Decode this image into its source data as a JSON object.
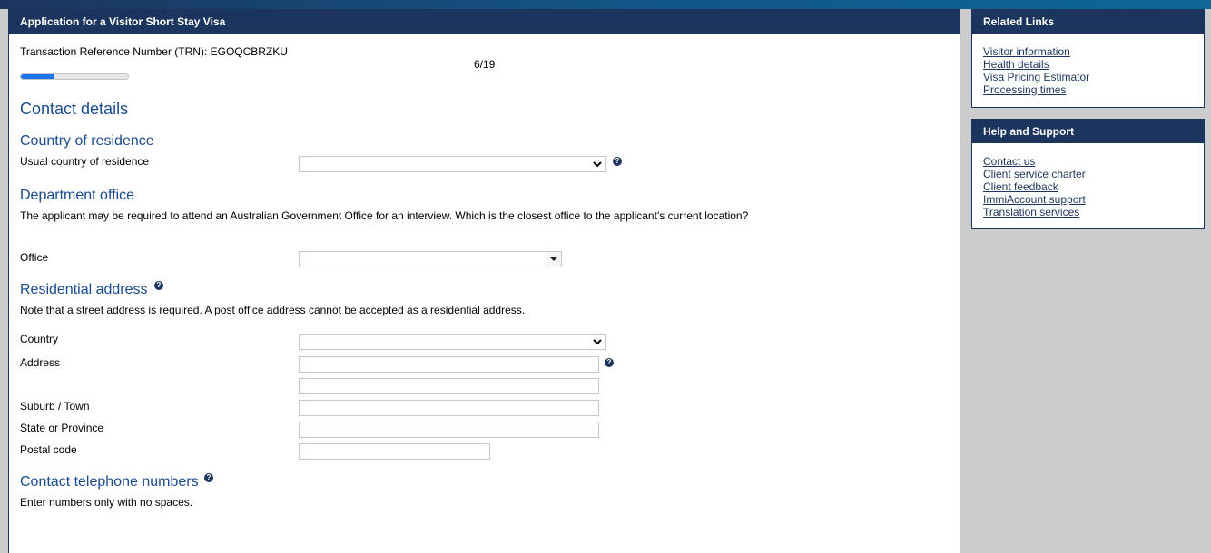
{
  "main": {
    "header_title": "Application for a Visitor Short Stay Visa",
    "trn_label": "Transaction Reference Number (TRN): EGOQCBRZKU",
    "step_text": "6/19",
    "progress_fraction": 0.316,
    "page_title": "Contact details",
    "country_of_residence": {
      "heading": "Country of residence",
      "field_label": "Usual country of residence",
      "value": ""
    },
    "department_office": {
      "heading": "Department office",
      "description": "The applicant may be required to attend an Australian Government Office for an interview. Which is the closest office to the applicant's current location?",
      "field_label": "Office",
      "value": ""
    },
    "residential_address": {
      "heading": "Residential address",
      "note": "Note that a street address is required. A post office address cannot be accepted as a residential address.",
      "country_label": "Country",
      "address_label": "Address",
      "suburb_label": "Suburb / Town",
      "state_label": "State or Province",
      "postal_label": "Postal code",
      "country_value": "",
      "address_line1": "",
      "address_line2": "",
      "suburb_value": "",
      "state_value": "",
      "postal_value": ""
    },
    "contact_telephone": {
      "heading": "Contact telephone numbers",
      "note": "Enter numbers only with no spaces."
    },
    "help_glyph": "?"
  },
  "sidebar": {
    "related_links": {
      "title": "Related Links",
      "links": [
        "Visitor information",
        "Health details",
        "Visa Pricing Estimator",
        "Processing times"
      ]
    },
    "help_support": {
      "title": "Help and Support",
      "links": [
        "Contact us",
        "Client service charter",
        "Client feedback",
        "ImmiAccount support",
        "Translation services"
      ]
    }
  },
  "colors": {
    "navy": "#1c355e",
    "heading_blue": "#1a4b8c",
    "progress_blue": "#1a73e8",
    "background_gray": "#cccccc"
  }
}
